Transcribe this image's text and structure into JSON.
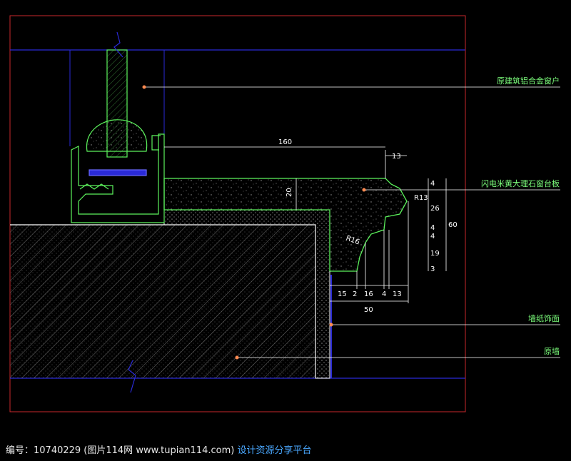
{
  "drawing": {
    "labels": {
      "window": "原建筑铝合金窗户",
      "sill": "闪电米黄大理石窗台板",
      "wallpaper": "墙纸饰面",
      "wall": "原墙"
    },
    "dimensions": {
      "d160": "160",
      "d13_top": "13",
      "d20": "20",
      "r13": "R13",
      "r16": "R16",
      "d4_top": "4",
      "d26": "26",
      "d4a": "4",
      "d4b": "4",
      "d19": "19",
      "d3": "3",
      "d60": "60",
      "d15": "15",
      "d2": "2",
      "d16": "16",
      "d4c": "4",
      "d13_bot": "13",
      "d50": "50"
    },
    "colors": {
      "border": "#c8282c",
      "blue": "#2a2ad8",
      "green": "#5cf25c",
      "white": "#ffffff",
      "label": "#7cff7c",
      "leader_dot": "#ff8a50",
      "cyan": "#3ad0d0"
    }
  },
  "footer": {
    "text": "编号：10740229 (图片114网 www.tupian114.com)",
    "tagline": "设计资源分享平台"
  }
}
